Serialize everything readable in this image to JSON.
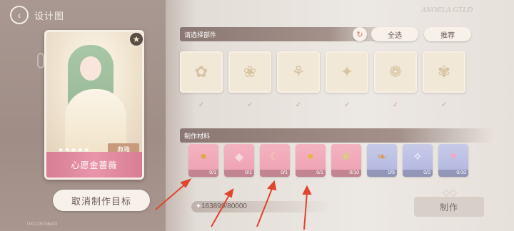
{
  "header": {
    "title": "设计图",
    "back_icon": "back-arrow-icon"
  },
  "card": {
    "name": "心愿金蔷薇",
    "stars": "★★★★★",
    "rank_label": "典雅",
    "pin_icon": "star-pin-icon"
  },
  "cancel_button_label": "取消制作目标",
  "uid_text": "UID:105786403",
  "decor_text": "ANOELA GTLD",
  "parts_section": {
    "title": "请选择部件",
    "refresh_icon": "refresh-icon",
    "select_all_label": "全选",
    "recommend_label": "推荐",
    "items": [
      {
        "name": "hair",
        "glyph": "✿"
      },
      {
        "name": "dress",
        "glyph": "❀"
      },
      {
        "name": "socks",
        "glyph": "⚘"
      },
      {
        "name": "shoes",
        "glyph": "✦"
      },
      {
        "name": "headpiece",
        "glyph": "❁"
      },
      {
        "name": "butterflies",
        "glyph": "✾"
      }
    ]
  },
  "materials_section": {
    "title": "制作材料",
    "items": [
      {
        "count": "0/1",
        "color": "pink",
        "glyph": "●",
        "icon_color": "#e0a44a"
      },
      {
        "count": "0/1",
        "color": "pink",
        "glyph": "◆",
        "icon_color": "#f6d9d9"
      },
      {
        "count": "0/1",
        "color": "pink",
        "glyph": "☾",
        "icon_color": "#f3d7a8"
      },
      {
        "count": "0/1",
        "color": "pink",
        "glyph": "●",
        "icon_color": "#e7b449"
      },
      {
        "count": "0/10",
        "color": "pink",
        "glyph": "❦",
        "icon_color": "#d5d07f"
      },
      {
        "count": "0/5",
        "color": "blue",
        "glyph": "❧",
        "icon_color": "#d99a54"
      },
      {
        "count": "0/2",
        "color": "blue",
        "glyph": "✧",
        "icon_color": "#ffffff"
      },
      {
        "count": "0/10",
        "color": "blue",
        "glyph": "♥",
        "icon_color": "#f1a9c1"
      }
    ]
  },
  "coins": {
    "value": "163899/80000",
    "icon": "coin-icon"
  },
  "make_button_label": "制作",
  "colors": {
    "accent_pink": "#e995a8",
    "arrow_red": "#e0452d"
  }
}
